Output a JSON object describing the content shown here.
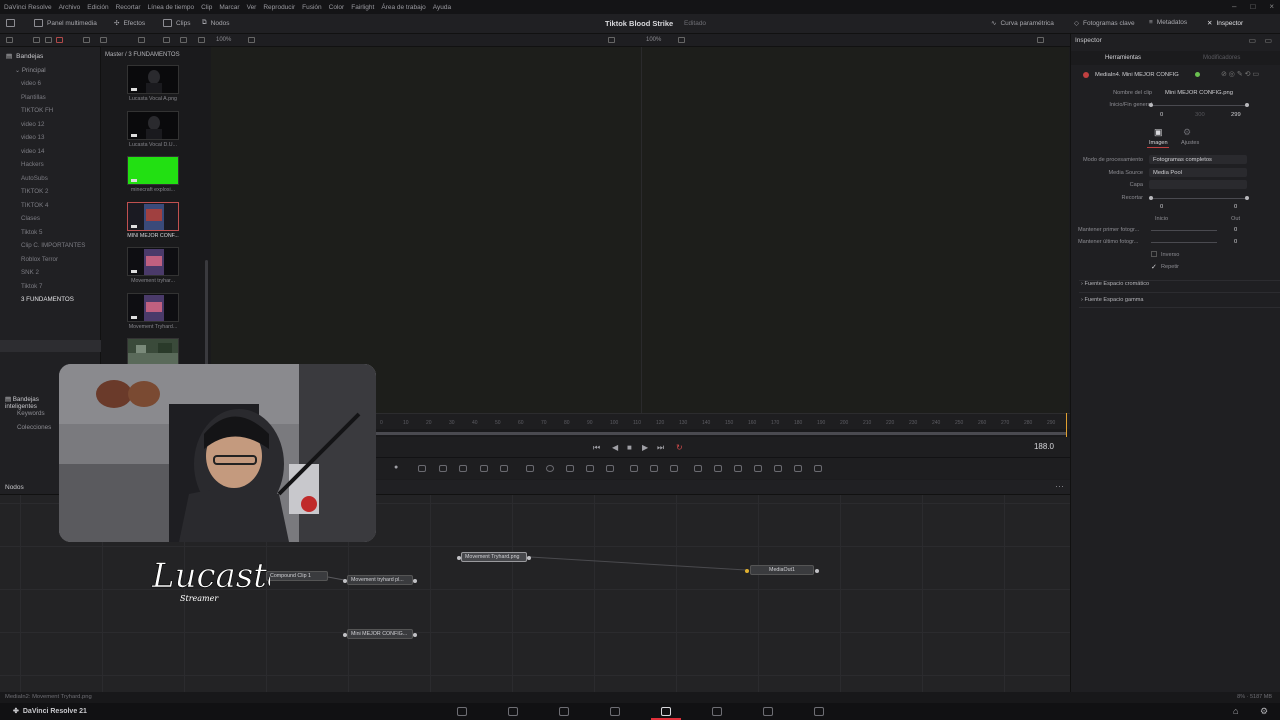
{
  "menubar": {
    "items": [
      "DaVinci Resolve",
      "Archivo",
      "Edición",
      "Recortar",
      "Línea de tiempo",
      "Clip",
      "Marcar",
      "Ver",
      "Reproducir",
      "Fusión",
      "Color",
      "Fairlight",
      "Área de trabajo",
      "Ayuda"
    ]
  },
  "toolbar": {
    "media_panel": "Panel multimedia",
    "effects": "Efectos",
    "clips": "Clips",
    "nodes": "Nodos",
    "project_title": "Tiktok Blood Strike",
    "project_status": "Editado",
    "curve": "Curva paramétrica",
    "keyframes": "Fotogramas clave",
    "metadata": "Metadatos",
    "inspector": "Inspector"
  },
  "subbar": {
    "zoom_left": "100%",
    "zoom_right": "100%"
  },
  "sidebar": {
    "title": "Bandejas",
    "root": "Principal",
    "bins": [
      "video 6",
      "Plantillas",
      "TIKTOK FH",
      "video 12",
      "video 13",
      "video 14",
      "Hackers",
      "AutoSubs",
      "TIKTOK 2",
      "TIKTOK 4",
      "Clases",
      "Tiktok 5",
      "Clip C. IMPORTANTES",
      "Roblox Terror",
      "SNK 2",
      "Tiktok 7",
      "3 FUNDAMENTOS"
    ],
    "selected_bin": "3 FUNDAMENTOS"
  },
  "smartbins": {
    "title": "Bandejas inteligentes",
    "items": [
      "Keywords",
      "Colecciones"
    ]
  },
  "mediapool": {
    "path": "Master / 3 FUNDAMENTOS",
    "clips": [
      {
        "label": "Lucasta Vocal A.png",
        "thumb": "dark-portrait"
      },
      {
        "label": "Lucasta Vocal D.U...",
        "thumb": "dark-portrait"
      },
      {
        "label": "minecraft explosi...",
        "thumb": "green-screen"
      },
      {
        "label": "MINI MEJOR CONF...",
        "thumb": "poster-selected"
      },
      {
        "label": "Movement tryhar...",
        "thumb": "poster"
      },
      {
        "label": "Movement Tryhard...",
        "thumb": "poster"
      },
      {
        "label": "",
        "thumb": "game-scene"
      }
    ]
  },
  "ruler": {
    "ticks": [
      "0",
      "10",
      "20",
      "30",
      "40",
      "50",
      "60",
      "70",
      "80",
      "90",
      "100",
      "110",
      "120",
      "130",
      "140",
      "150",
      "160",
      "170",
      "180",
      "190",
      "200",
      "210",
      "220",
      "230",
      "240",
      "250",
      "260",
      "270",
      "280",
      "290"
    ]
  },
  "transport": {
    "timecode": "188.0"
  },
  "nodes_panel": {
    "title": "Nodos",
    "nodes": [
      {
        "id": "compound",
        "label": "Compound Clip 1",
        "color": "#8a8a8e"
      },
      {
        "id": "movement1",
        "label": "Movement tryhard pl...",
        "color": "#7a8a60"
      },
      {
        "id": "movement2",
        "label": "Movement Tryhard.png",
        "color": "#7ab050"
      },
      {
        "id": "mini",
        "label": "Mini MEJOR CONFIG...",
        "color": "#c06a6a"
      },
      {
        "id": "mediaout",
        "label": "MediaOut1",
        "color": "#8a8a8e"
      }
    ]
  },
  "logo": {
    "text": "Lucasta",
    "sub": "Streamer"
  },
  "inspector": {
    "title": "Inspector",
    "tab_tools": "Herramientas",
    "tab_modifiers": "Modificadores",
    "node_name": "MediaIn4. Mini MEJOR CONFIG",
    "clip_name_label": "Nombre del clip",
    "clip_name_value": "Mini MEJOR CONFIG.png",
    "range_label": "Inicio/Fin general",
    "range_start": "0",
    "range_mid": "300",
    "range_end": "299",
    "sub_tab_image": "Imagen",
    "sub_tab_settings": "Ajustes",
    "processing_mode_label": "Modo de procesamiento",
    "processing_mode_value": "Fotogramas completos",
    "media_source_label": "Media Source",
    "media_source_value": "Media Pool",
    "layer_label": "Capa",
    "trim_label": "Recortar",
    "trim_in": "0",
    "trim_out": "0",
    "trim_in_label": "Inicio",
    "trim_out_label": "Out",
    "hold_first_label": "Mantener primer fotogr...",
    "hold_first_value": "0",
    "hold_last_label": "Mantener último fotogr...",
    "hold_last_value": "0",
    "reverse_label": "Inverso",
    "loop_label": "Repetir",
    "color_space_label": "Fuente Espacio cromático",
    "gamma_space_label": "Fuente Espacio gamma"
  },
  "statusbar": {
    "text": "MediaIn2: Movement Tryhard.png",
    "mem": "8% · 5187 MB"
  },
  "pagebar": {
    "app_name": "DaVinci Resolve 21",
    "pages": [
      "media",
      "cut",
      "edit",
      "fusion",
      "color",
      "fairlight",
      "deliver"
    ],
    "active_page": "fusion"
  }
}
